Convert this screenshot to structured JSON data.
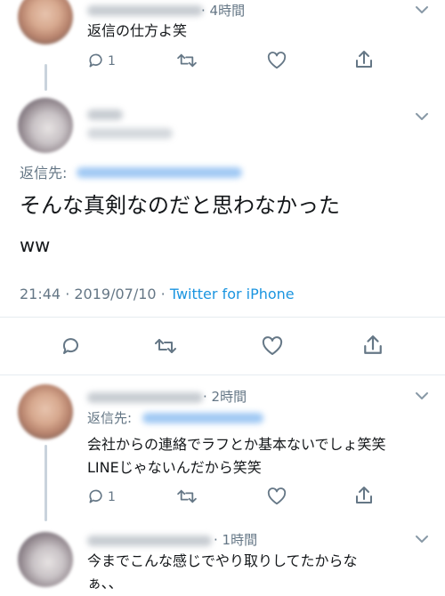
{
  "tweet1": {
    "time_label": "· 4時間",
    "text": "返信の仕方よ笑",
    "reply_count": "1"
  },
  "main_tweet": {
    "replying_to_label": "返信先:",
    "text_line1": "そんな真剣なのだと思わなかった",
    "text_line2": "ww",
    "timestamp": "21:44 · 2019/07/10 · ",
    "source": "Twitter for iPhone"
  },
  "tweet3": {
    "time_label": "· 2時間",
    "replying_to_label": "返信先:",
    "text_line1": "会社からの連絡でラフとか基本ないでしょ笑笑",
    "text_line2": "LINEじゃないんだから笑笑",
    "reply_count": "1"
  },
  "tweet4": {
    "time_label": "· 1時間",
    "text_line1": "今までこんな感じでやり取りしてたからな",
    "text_line2": "ぁ、、"
  },
  "icons": {
    "reply": "reply-icon",
    "retweet": "retweet-icon",
    "like": "heart-icon",
    "share": "share-icon",
    "more": "chevron-down-icon"
  },
  "colors": {
    "link": "#1b95e0",
    "secondary_text": "#657786",
    "divider": "#e6ecf0"
  }
}
